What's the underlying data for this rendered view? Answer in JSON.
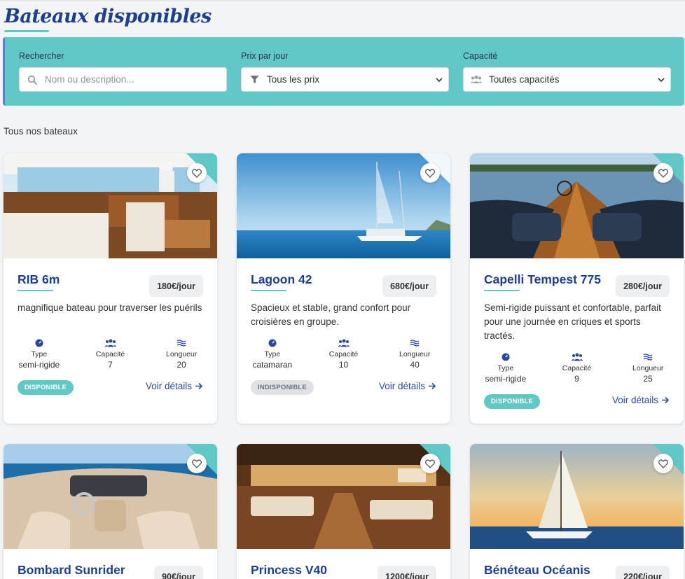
{
  "page": {
    "title": "Bateaux disponibles",
    "section_label": "Tous nos bateaux"
  },
  "filters": {
    "search": {
      "label": "Rechercher",
      "placeholder": "Nom ou description..."
    },
    "price": {
      "label": "Prix par jour",
      "value": "Tous les prix"
    },
    "capacity": {
      "label": "Capacité",
      "value": "Toutes capacités"
    }
  },
  "spec_labels": {
    "type": "Type",
    "capacity": "Capacité",
    "length": "Longueur"
  },
  "details_label": "Voir détails",
  "colors": {
    "accent": "#62c8c5",
    "brand": "#1e3f8a",
    "link": "#2a4a9a"
  },
  "boats": [
    {
      "name": "RIB 6m",
      "price": "180€/jour",
      "description": "magnifique bateau pour traverser les puérils",
      "type": "semi-rigide",
      "capacity": "7",
      "length": "20",
      "status": "DISPONIBLE"
    },
    {
      "name": "Lagoon 42",
      "price": "680€/jour",
      "description": "Spacieux et stable, grand confort pour croisières en groupe.",
      "type": "catamaran",
      "capacity": "10",
      "length": "40",
      "status": "INDISPONIBLE"
    },
    {
      "name": "Capelli Tempest 775",
      "price": "280€/jour",
      "description": "Semi-rigide puissant et confortable, parfait pour une journée en criques et sports tractés.",
      "type": "semi-rigide",
      "capacity": "9",
      "length": "25",
      "status": "DISPONIBLE"
    },
    {
      "name": "Bombard Sunrider",
      "price": "90€/jour"
    },
    {
      "name": "Princess V40",
      "price": "1200€/jour"
    },
    {
      "name": "Bénéteau Océanis",
      "price": "220€/jour"
    }
  ]
}
